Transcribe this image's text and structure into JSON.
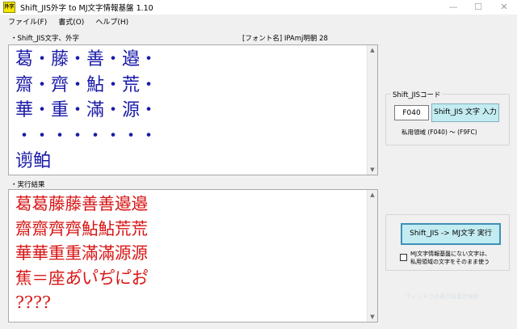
{
  "window": {
    "title": "Shift_JIS外字 to MJ文字情報基盤 1.10",
    "icon_text": "外字",
    "controls": [
      "—",
      "☐",
      "✕"
    ]
  },
  "menu": [
    "ファイル(F)",
    "書式(O)",
    "ヘルプ(H)"
  ],
  "input_area": {
    "label": "・Shift_JIS文字、外字",
    "font_label": "[フォント名] IPAmj明朝 28",
    "text": "葛・藤・善・邉・\n齋・齊・鮎・荒・\n華・重・滿・源・\n・・・・・・・・\n谫鲌"
  },
  "result_area": {
    "label": "・実行結果",
    "text": "葛葛藤藤善善邉邉\n齋齋齊齊鮎鮎荒荒\n華華重重滿滿源源\n蕉＝座あ゚い゚ち゚に゚お゚\n????"
  },
  "sjis_panel": {
    "group_title": "Shift_JISコード",
    "code_value": "F040",
    "input_button": "Shift_JIS 文字 入力",
    "range_text": "私用領域 (F040) ～ (F9FC)"
  },
  "exec_panel": {
    "exec_button": "Shift_JIS -> MJ文字  実行",
    "checkbox_checked": false,
    "checkbox_label": "MJ文字情報基盤にない文字は、\n私用領域の文字をそのまま使う"
  },
  "ghost_text": "ウィンドウの表示位置の保存",
  "colors": {
    "input_text": "#1a1aa8",
    "result_text": "#d81414",
    "button_bg": "#c3ecf2"
  }
}
